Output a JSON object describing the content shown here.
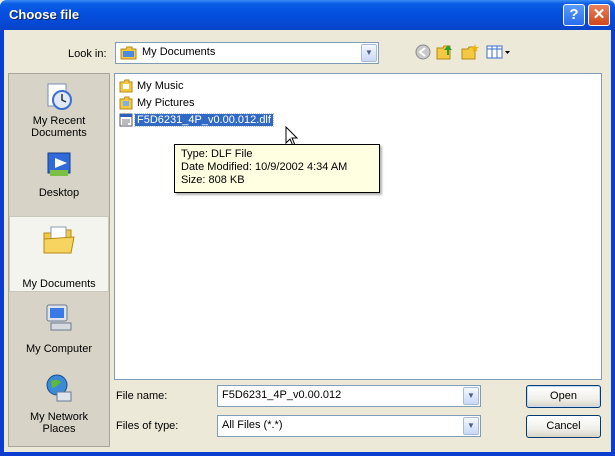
{
  "window": {
    "title": "Choose file",
    "help_label": "?",
    "close_label": "✕"
  },
  "lookin": {
    "label": "Look in:",
    "value": "My Documents"
  },
  "places": [
    {
      "label": "My Recent Documents",
      "icon": "recent-documents-icon"
    },
    {
      "label": "Desktop",
      "icon": "desktop-icon"
    },
    {
      "label": "My Documents",
      "icon": "my-documents-icon"
    },
    {
      "label": "My Computer",
      "icon": "my-computer-icon"
    },
    {
      "label": "My Network Places",
      "icon": "network-places-icon"
    }
  ],
  "files": [
    {
      "name": "My Music",
      "type": "folder"
    },
    {
      "name": "My Pictures",
      "type": "folder"
    },
    {
      "name": "F5D6231_4P_v0.00.012.dlf",
      "type": "file",
      "selected": true
    }
  ],
  "tooltip": {
    "line1": "Type: DLF File",
    "line2": "Date Modified: 10/9/2002 4:34 AM",
    "line3": "Size: 808 KB"
  },
  "filename": {
    "label": "File name:",
    "value": "F5D6231_4P_v0.00.012"
  },
  "filetype": {
    "label": "Files of type:",
    "value": "All Files (*.*)"
  },
  "buttons": {
    "open": "Open",
    "cancel": "Cancel"
  },
  "colors": {
    "title_bar": "#0550e0",
    "selection": "#316ac5",
    "face": "#ece9d8"
  }
}
